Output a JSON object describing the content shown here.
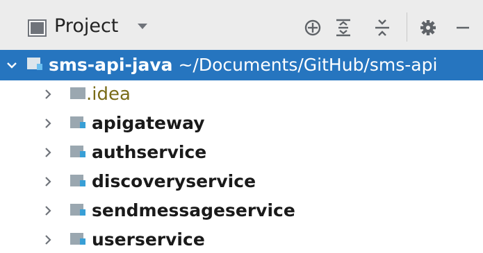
{
  "toolbar": {
    "title": "Project",
    "icons": [
      "project-view-icon",
      "dropdown-arrow-icon",
      "locate-icon",
      "expand-all-icon",
      "collapse-all-icon",
      "gear-icon",
      "hide-icon"
    ]
  },
  "tree": {
    "root": {
      "name": "sms-api-java",
      "path": "~/Documents/GitHub/sms-api"
    },
    "items": [
      {
        "label": ".idea"
      },
      {
        "label": "apigateway"
      },
      {
        "label": "authservice"
      },
      {
        "label": "discoveryservice"
      },
      {
        "label": "sendmessageservice"
      },
      {
        "label": "userservice"
      }
    ]
  },
  "colors": {
    "selection": "#2675bf",
    "folder_gray": "#9aa7b0",
    "module_blue": "#389fd6",
    "idea_text": "#7a6c18"
  }
}
